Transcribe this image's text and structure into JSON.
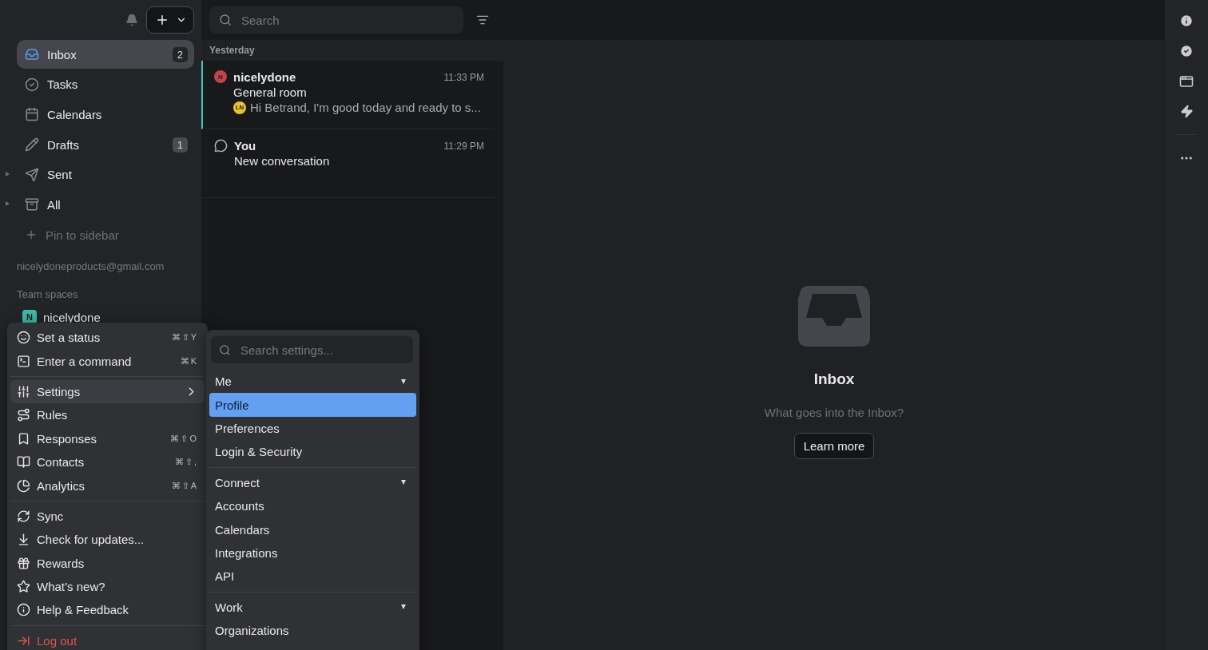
{
  "sidebar": {
    "items": [
      {
        "label": "Inbox",
        "badge": "2",
        "selected": true,
        "expandable": false
      },
      {
        "label": "Tasks",
        "selected": false,
        "expandable": false
      },
      {
        "label": "Calendars",
        "selected": false,
        "expandable": false
      },
      {
        "label": "Drafts",
        "badge": "1",
        "selected": false,
        "expandable": false
      },
      {
        "label": "Sent",
        "selected": false,
        "expandable": true
      },
      {
        "label": "All",
        "selected": false,
        "expandable": true
      }
    ],
    "pin_action": "Pin to sidebar",
    "account": "nicelydoneproducts@gmail.com",
    "team_spaces_heading": "Team spaces",
    "team_spaces": [
      {
        "initial": "N",
        "name": "nicelydone",
        "color": "#3fb9a8"
      }
    ]
  },
  "message_list": {
    "search": {
      "placeholder": "Search"
    },
    "group": "Yesterday",
    "conversations": [
      {
        "kind": "room",
        "avatar": "N",
        "color": "#c0454a",
        "sender": "nicelydone",
        "time": "11:33 PM",
        "subject": "General room",
        "preview_avatar": "LN",
        "preview": "Hi Betrand, I'm good today and ready to s...",
        "selected": true
      },
      {
        "kind": "chat",
        "sender": "You",
        "time": "11:29 PM",
        "subject": "New conversation",
        "selected": false
      }
    ]
  },
  "empty_state": {
    "title": "Inbox",
    "subtitle": "What goes into the Inbox?",
    "button": "Learn more"
  },
  "account_menu": {
    "sections": [
      [
        {
          "label": "Set a status",
          "shortcut": "⌘⇧Y",
          "kind": "normal",
          "selected": false
        },
        {
          "label": "Enter a command",
          "shortcut": "⌘K",
          "kind": "normal",
          "selected": false
        }
      ],
      [
        {
          "label": "Settings",
          "kind": "submenu",
          "selected": true
        },
        {
          "label": "Rules",
          "kind": "normal",
          "selected": false
        },
        {
          "label": "Responses",
          "shortcut": "⌘⇧O",
          "kind": "normal",
          "selected": false
        },
        {
          "label": "Contacts",
          "shortcut": "⌘⇧,",
          "kind": "normal",
          "selected": false
        },
        {
          "label": "Analytics",
          "shortcut": "⌘⇧A",
          "kind": "normal",
          "selected": false
        }
      ],
      [
        {
          "label": "Sync",
          "kind": "normal",
          "selected": false
        },
        {
          "label": "Check for updates...",
          "kind": "normal",
          "selected": false
        },
        {
          "label": "Rewards",
          "kind": "normal",
          "selected": false
        },
        {
          "label": "What’s new?",
          "kind": "normal",
          "selected": false
        },
        {
          "label": "Help & Feedback",
          "kind": "normal",
          "selected": false
        }
      ],
      [
        {
          "label": "Log out",
          "kind": "danger",
          "selected": false
        }
      ]
    ]
  },
  "settings_menu": {
    "search": {
      "placeholder": "Search settings..."
    },
    "sections": [
      {
        "title": "Me",
        "expanded": true,
        "items": [
          {
            "label": "Profile",
            "selected": true
          },
          {
            "label": "Preferences",
            "selected": false
          },
          {
            "label": "Login & Security",
            "selected": false
          }
        ]
      },
      {
        "title": "Connect",
        "expanded": true,
        "items": [
          {
            "label": "Accounts",
            "selected": false
          },
          {
            "label": "Calendars",
            "selected": false
          },
          {
            "label": "Integrations",
            "selected": false
          },
          {
            "label": "API",
            "selected": false
          }
        ]
      },
      {
        "title": "Work",
        "expanded": true,
        "items": [
          {
            "label": "Organizations",
            "selected": false
          }
        ]
      }
    ]
  }
}
